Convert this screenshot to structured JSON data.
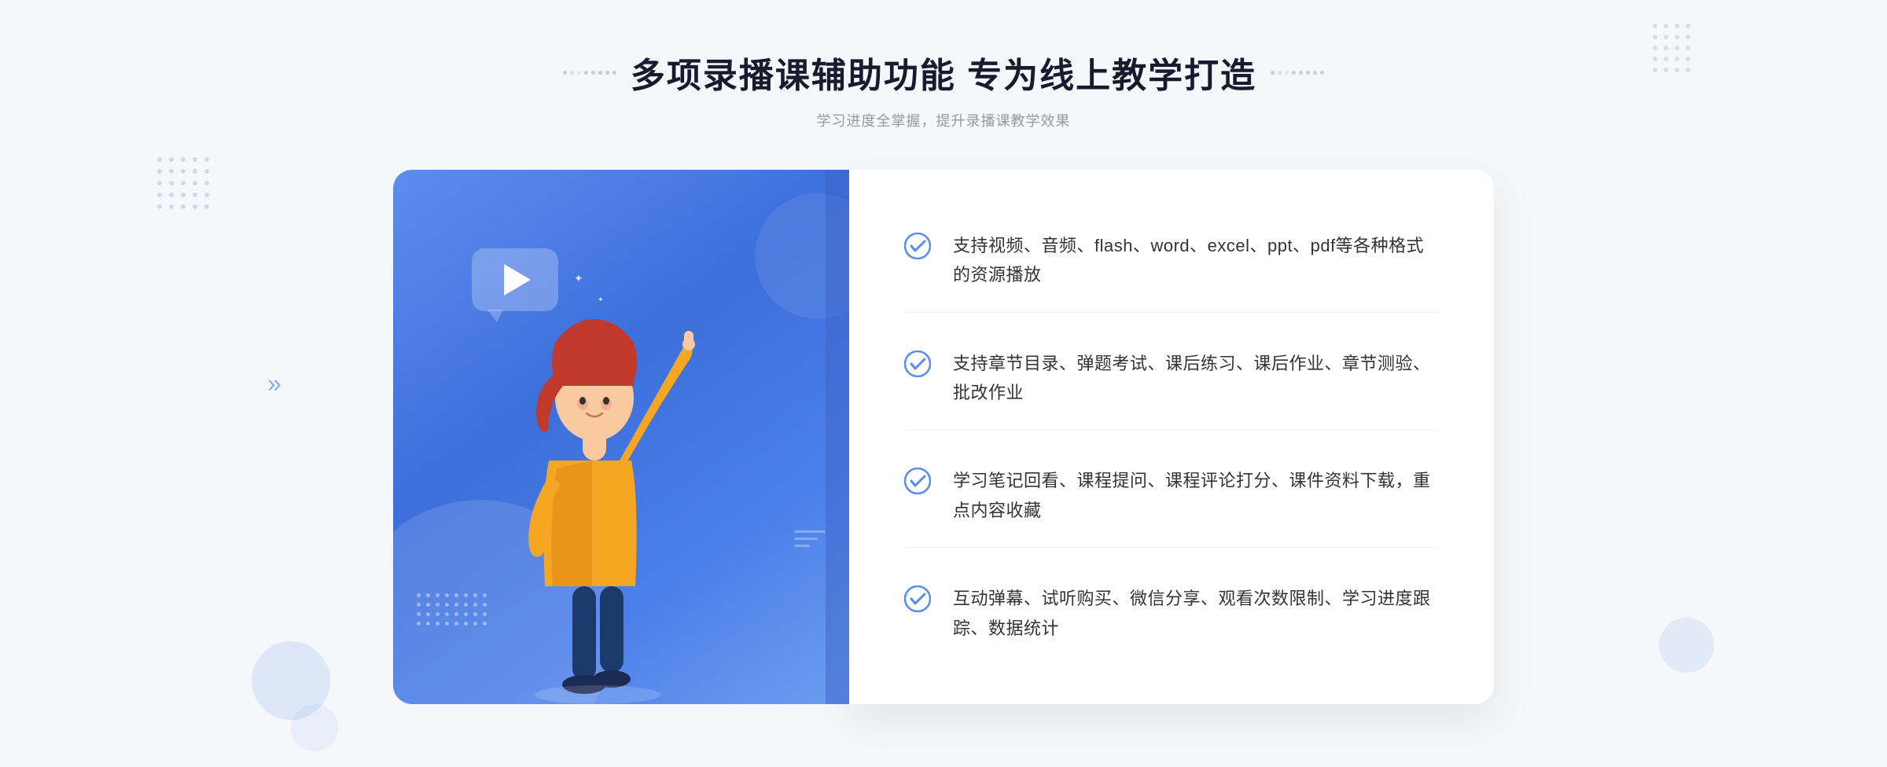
{
  "header": {
    "title": "多项录播课辅助功能 专为线上教学打造",
    "subtitle": "学习进度全掌握，提升录播课教学效果",
    "decorative_label_left": ":::",
    "decorative_label_right": ":::"
  },
  "features": [
    {
      "id": "feature-1",
      "text": "支持视频、音频、flash、word、excel、ppt、pdf等各种格式的资源播放"
    },
    {
      "id": "feature-2",
      "text": "支持章节目录、弹题考试、课后练习、课后作业、章节测验、批改作业"
    },
    {
      "id": "feature-3",
      "text": "学习笔记回看、课程提问、课程评论打分、课件资料下载，重点内容收藏"
    },
    {
      "id": "feature-4",
      "text": "互动弹幕、试听购买、微信分享、观看次数限制、学习进度跟踪、数据统计"
    }
  ],
  "colors": {
    "primary": "#4a7ee8",
    "primary_light": "#5b8dee",
    "text_dark": "#1a1a2e",
    "text_gray": "#999999",
    "text_body": "#333333",
    "check_color": "#5b8dee",
    "bg": "#f5f7fa"
  }
}
